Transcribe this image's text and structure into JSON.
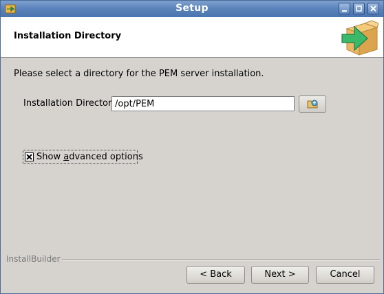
{
  "window": {
    "title": "Setup",
    "controls": [
      "minimize-icon",
      "maximize-icon",
      "close-icon"
    ],
    "titlebar_color": "#5d85bc"
  },
  "header": {
    "title": "Installation Directory",
    "logo_icon": "box-arrow-icon"
  },
  "main": {
    "instruction": "Please select a directory for the PEM server installation.",
    "directory_label": "Installation Directory",
    "directory_value": "/opt/PEM",
    "browse_icon": "folder-browse-icon",
    "advanced": {
      "label_pre": "Show ",
      "label_mnemonic": "a",
      "label_post": "dvanced options",
      "checked": true
    }
  },
  "footer": {
    "brand": "InstallBuilder",
    "back_label": "< Back",
    "next_label": "Next >",
    "cancel_label": "Cancel"
  }
}
